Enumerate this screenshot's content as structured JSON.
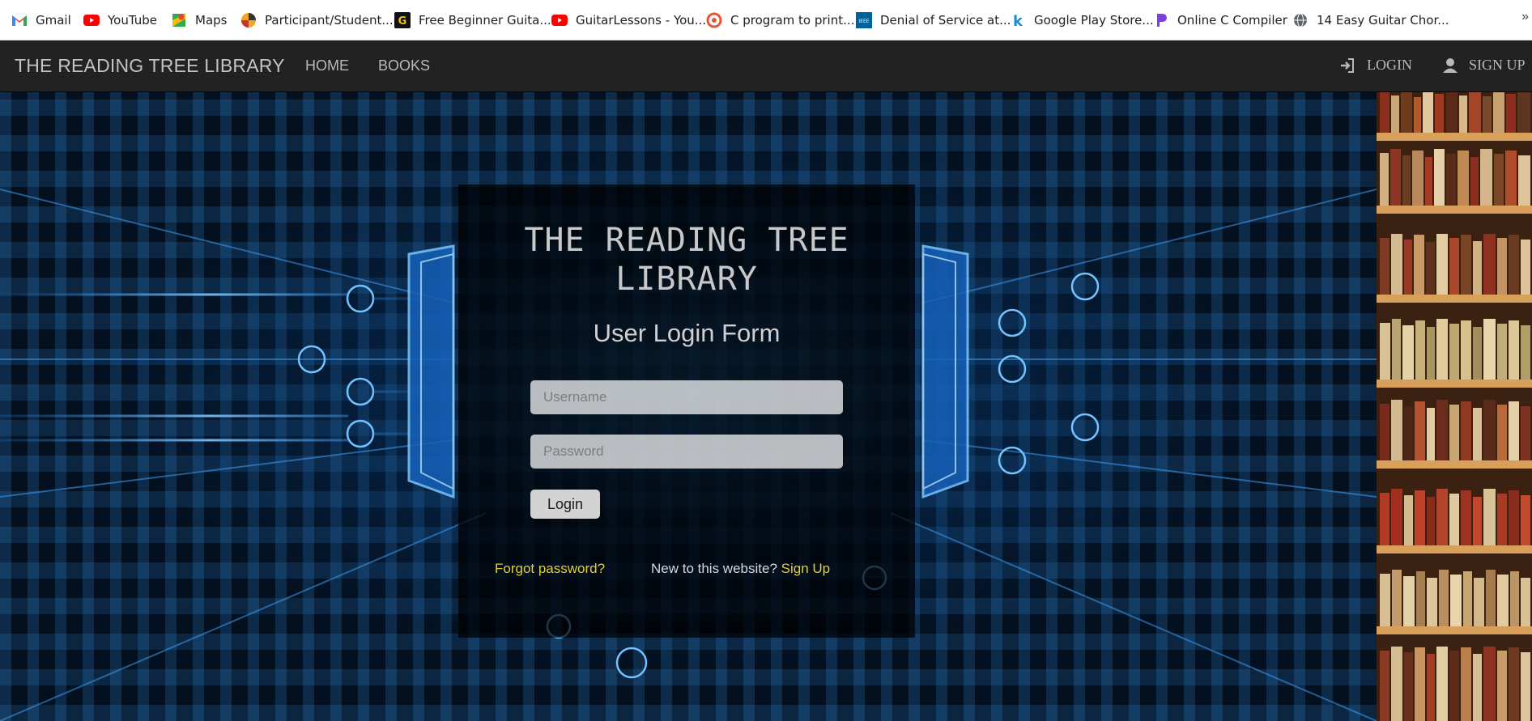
{
  "bookmarks": [
    {
      "label": "Gmail",
      "icon": "gmail-icon"
    },
    {
      "label": "YouTube",
      "icon": "youtube-icon"
    },
    {
      "label": "Maps",
      "icon": "maps-icon"
    },
    {
      "label": "Participant/Student...",
      "icon": "participant-site-icon"
    },
    {
      "label": "Free Beginner Guita...",
      "icon": "guitar-site-icon"
    },
    {
      "label": "GuitarLessons - You...",
      "icon": "youtube-icon"
    },
    {
      "label": "C program to print...",
      "icon": "c-program-site-icon"
    },
    {
      "label": "Denial of Service at...",
      "icon": "ieee-icon"
    },
    {
      "label": "Google Play Store...",
      "icon": "k-site-icon"
    },
    {
      "label": "Online C Compiler",
      "icon": "compiler-site-icon"
    },
    {
      "label": "14 Easy Guitar Chor...",
      "icon": "globe-icon"
    }
  ],
  "bookmarks_more": "»",
  "navbar": {
    "brand": "THE READING TREE LIBRARY",
    "links": [
      "HOME",
      "BOOKS"
    ],
    "login": "LOGIN",
    "signup": "SIGN UP"
  },
  "form": {
    "title": "THE READING TREE LIBRARY",
    "subtitle": "User Login Form",
    "username_placeholder": "Username",
    "password_placeholder": "Password",
    "button": "Login",
    "forgot": "Forgot password?",
    "new_text": "New to this website? ",
    "signup_link": "Sign Up"
  },
  "colors": {
    "navbar_bg": "#222222",
    "link_accent": "#e3d02c"
  }
}
